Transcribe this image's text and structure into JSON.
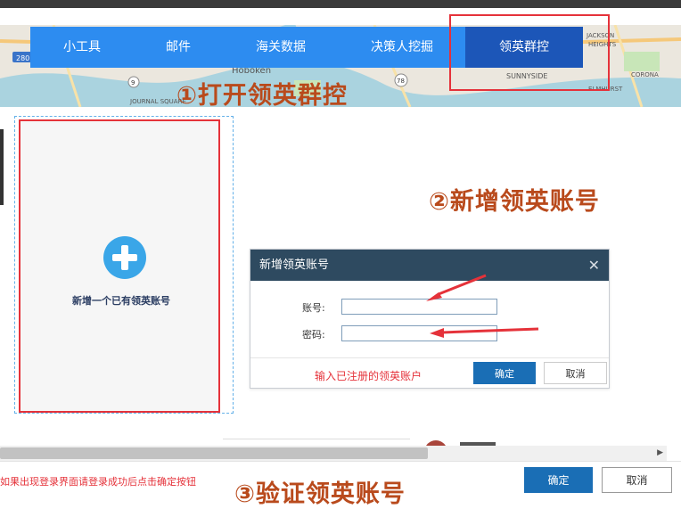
{
  "nav": {
    "items": [
      "小工具",
      "邮件",
      "海关数据",
      "决策人挖掘",
      "领英群控"
    ],
    "active_index": 4
  },
  "map": {
    "labels": [
      "Hoboken",
      "SUNNYSIDE",
      "JACKSON",
      "HEIGHTS",
      "CORONA",
      "ELMHURST",
      "JOURNAL SQUARE",
      "280",
      "9",
      "78"
    ]
  },
  "steps": {
    "step1": "①打开领英群控",
    "step2": "②新增领英账号",
    "step3": "③验证领英账号"
  },
  "add_card": {
    "label": "新增一个已有领英账号"
  },
  "dialog": {
    "title": "新增领英账号",
    "close": "✕",
    "account_label": "账号:",
    "password_label": "密码:",
    "account_value": "",
    "password_value": "",
    "note": "输入已注册的领英账户",
    "ok": "确定",
    "cancel": "取消"
  },
  "footer": {
    "note": "如果出现登录界面请登录成功后点击确定按钮",
    "ok": "确定",
    "cancel": "取消"
  },
  "colors": {
    "nav_bg": "#2d8cf0",
    "nav_active": "#1c56b8",
    "highlight": "#e5323a",
    "step_text": "#b94a1c",
    "dialog_header": "#2e4a60",
    "primary_button": "#1a6eb5"
  },
  "icons": {
    "add": "plus-circle-icon",
    "close": "close-icon",
    "scroll_right": "arrow-right-icon"
  }
}
